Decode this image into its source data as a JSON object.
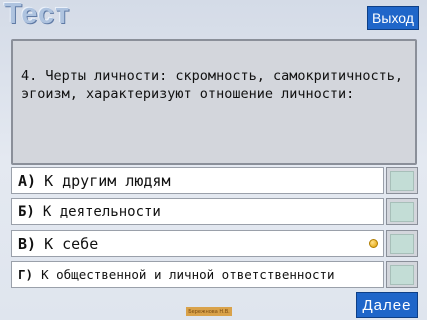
{
  "header": {
    "title": "Тест",
    "exit_label": "Выход"
  },
  "question": {
    "text": "4. Черты личности: скромность, самокритичность, эгоизм, характеризуют отношение личности:"
  },
  "answers": [
    {
      "letter": "А)",
      "text": "К другим людям"
    },
    {
      "letter": "Б)",
      "text": "К деятельности"
    },
    {
      "letter": "В)",
      "text": "К себе"
    },
    {
      "letter": "Г)",
      "text": "К общественной и личной ответственности"
    }
  ],
  "footer": {
    "next_label": "Далее",
    "author_badge": "Бережнова Н.В."
  },
  "colors": {
    "button_blue": "#1f66c9",
    "slot_fill": "#c3ddd6",
    "marker": "#e0a000"
  }
}
